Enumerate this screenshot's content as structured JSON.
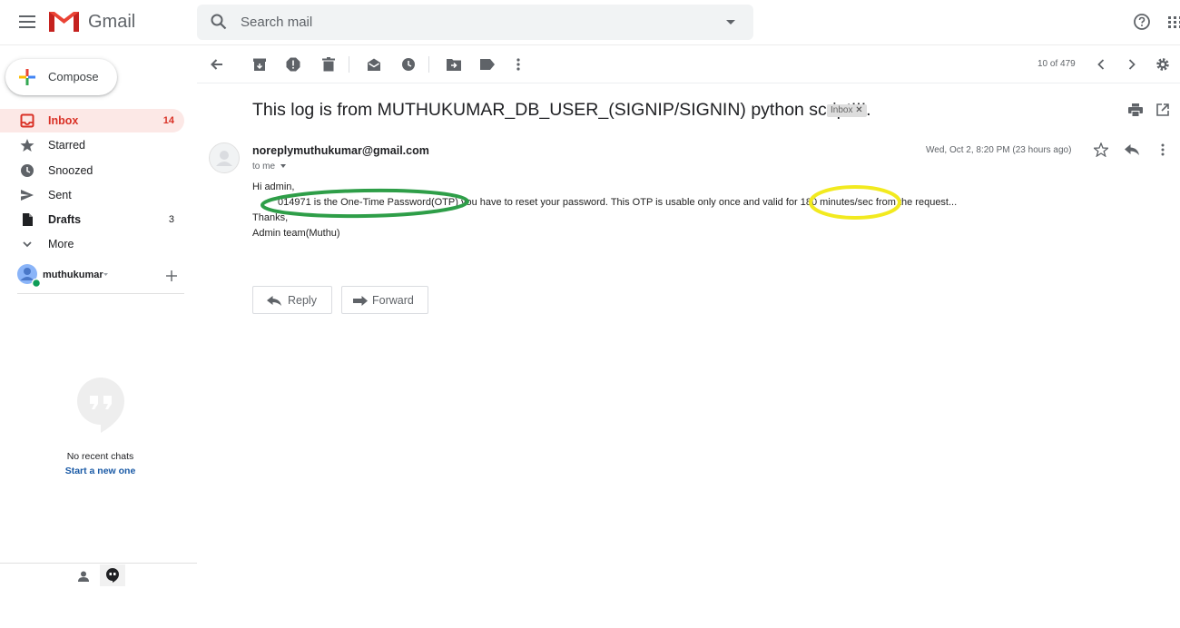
{
  "app": {
    "name": "Gmail"
  },
  "search": {
    "placeholder": "Search mail"
  },
  "sidebar": {
    "compose_label": "Compose",
    "items": [
      {
        "label": "Inbox",
        "count": "14",
        "icon": "inbox-icon"
      },
      {
        "label": "Starred",
        "count": "",
        "icon": "star-icon"
      },
      {
        "label": "Snoozed",
        "count": "",
        "icon": "clock-icon"
      },
      {
        "label": "Sent",
        "count": "",
        "icon": "send-icon"
      },
      {
        "label": "Drafts",
        "count": "3",
        "icon": "draft-icon"
      },
      {
        "label": "More",
        "count": "",
        "icon": "chevron-down-icon"
      }
    ],
    "account_name": "muthukumar"
  },
  "toolbar": {
    "pagination": "10 of 479"
  },
  "email": {
    "subject": "This log is from MUTHUKUMAR_DB_USER_(SIGNIP/SIGNIN) python script!!!.",
    "label_chip": "Inbox",
    "sender": "noreplymuthukumar@gmail.com",
    "to": "to me",
    "date": "Wed, Oct 2, 8:20 PM (23 hours ago)",
    "body": {
      "greeting": "Hi admin,",
      "line1": "014971 is the One-Time Password(OTP) you have to reset your password. This OTP is usable only once and valid for 180 minutes/sec from the request...",
      "thanks": "Thanks,",
      "signature": "Admin team(Muthu)"
    }
  },
  "actions": {
    "reply": "Reply",
    "forward": "Forward"
  },
  "chat": {
    "empty_text": "No recent chats",
    "start_link": "Start a new one"
  },
  "colors": {
    "inbox_active": "#d93025",
    "inbox_bg": "#fce8e6",
    "annotation_green": "#2e9e48",
    "annotation_yellow": "#f2ea1f",
    "link": "#1a5aa6"
  }
}
